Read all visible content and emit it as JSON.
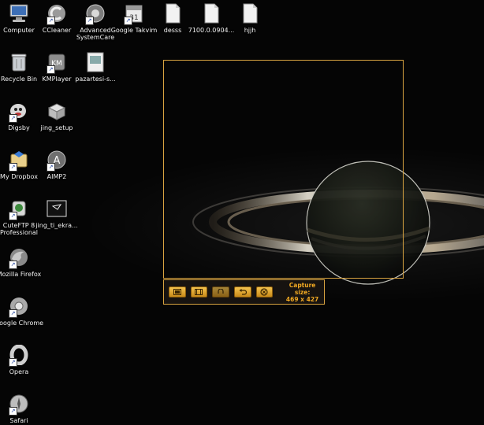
{
  "desktop": {
    "icons": [
      {
        "label": "Computer",
        "icon": "computer-icon"
      },
      {
        "label": "CCleaner",
        "icon": "ccleaner-icon"
      },
      {
        "label": "Advanced SystemCare",
        "icon": "advanced-systemcare-icon"
      },
      {
        "label": "Google Takvim",
        "icon": "google-calendar-icon"
      },
      {
        "label": "desss",
        "icon": "file-icon"
      },
      {
        "label": "7100.0.0904...",
        "icon": "file-icon"
      },
      {
        "label": "hjjh",
        "icon": "file-icon"
      },
      {
        "label": "Recycle Bin",
        "icon": "recycle-bin-icon"
      },
      {
        "label": "KMPlayer",
        "icon": "kmplayer-icon"
      },
      {
        "label": "pazartesi-s...",
        "icon": "image-file-icon"
      },
      {
        "label": "Digsby",
        "icon": "digsby-icon"
      },
      {
        "label": "jing_setup",
        "icon": "setup-box-icon"
      },
      {
        "label": "My Dropbox",
        "icon": "dropbox-icon"
      },
      {
        "label": "AIMP2",
        "icon": "aimp-icon"
      },
      {
        "label": "CuteFTP 8 Professional",
        "icon": "cuteftp-icon"
      },
      {
        "label": "jing_ti_ekra...",
        "icon": "image-file-icon"
      },
      {
        "label": "Mozilla Firefox",
        "icon": "firefox-icon"
      },
      {
        "label": "Google Chrome",
        "icon": "chrome-icon"
      },
      {
        "label": "Opera",
        "icon": "opera-icon"
      },
      {
        "label": "Safari",
        "icon": "safari-icon"
      }
    ]
  },
  "capture": {
    "size_title": "Capture size:",
    "size_value": "469 x 427",
    "tools": [
      {
        "icon": "capture-image-icon"
      },
      {
        "icon": "capture-video-icon"
      },
      {
        "icon": "capture-audio-icon"
      },
      {
        "icon": "undo-icon"
      },
      {
        "icon": "cancel-icon"
      }
    ]
  },
  "colors": {
    "frame": "#d9a441",
    "capture_text": "#f0a822",
    "background": "#050505"
  }
}
